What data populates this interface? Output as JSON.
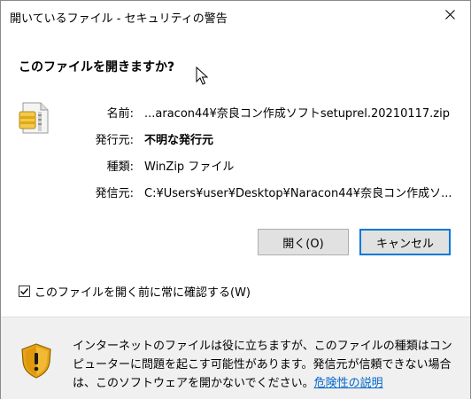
{
  "window": {
    "title": "開いているファイル - セキュリティの警告"
  },
  "dialog": {
    "heading": "このファイルを開きますか?",
    "fields": {
      "name_label": "名前:",
      "name_value": "...aracon44¥奈良コン作成ソフトsetuprel.20210117.zip",
      "publisher_label": "発行元:",
      "publisher_value": "不明な発行元",
      "type_label": "種類:",
      "type_value": "WinZip ファイル",
      "from_label": "発信元:",
      "from_value": "C:¥Users¥user¥Desktop¥Naracon44¥奈良コン作成ソ..."
    },
    "buttons": {
      "open": "開く(O)",
      "cancel": "キャンセル"
    },
    "checkbox": {
      "label": "このファイルを開く前に常に確認する(W)",
      "checked": true
    },
    "warning": {
      "text": "インターネットのファイルは役に立ちますが、このファイルの種類はコンピューターに問題を起こす可能性があります。発信元が信頼できない場合は、このソフトウェアを開かないでください。",
      "link": "危険性の説明"
    }
  }
}
